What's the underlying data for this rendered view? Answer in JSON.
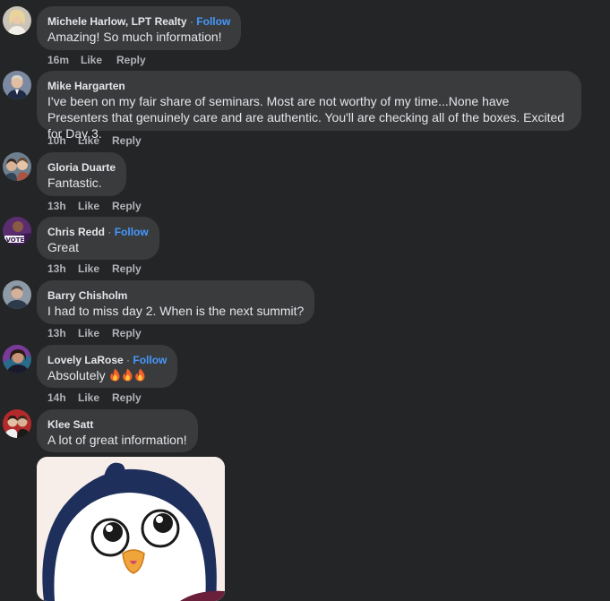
{
  "comments": [
    {
      "author": "Michele Harlow, LPT Realty",
      "follow": "Follow",
      "separator": "·",
      "text": "Amazing! So much information!",
      "time": "16m",
      "like": "Like",
      "reply": "Reply"
    },
    {
      "author": "Mike Hargarten",
      "text": "I've been on my fair share of seminars. Most are not worthy of my time...None have Presenters that genuinely care and are authentic. You'll are checking all of the boxes. Excited for Day 3.",
      "time": "10h",
      "like": "Like",
      "reply": "Reply"
    },
    {
      "author": "Gloria Duarte",
      "text": "Fantastic.",
      "time": "13h",
      "like": "Like",
      "reply": "Reply"
    },
    {
      "author": "Chris Redd",
      "follow": "Follow",
      "separator": "·",
      "text": "Great",
      "time": "13h",
      "like": "Like",
      "reply": "Reply"
    },
    {
      "author": "Barry Chisholm",
      "text": "I had to miss day 2. When is the next summit?",
      "time": "13h",
      "like": "Like",
      "reply": "Reply"
    },
    {
      "author": "Lovely LaRose",
      "follow": "Follow",
      "separator": "·",
      "text": "Absolutely",
      "time": "14h",
      "like": "Like",
      "reply": "Reply"
    },
    {
      "author": "Klee Satt",
      "text": "A lot of great information!"
    }
  ],
  "icons": {
    "fire": "fire-emoji-icon",
    "sticker": "penguin-sticker"
  },
  "colors": {
    "background": "#242526",
    "bubble": "#3a3b3c",
    "text": "#e4e6eb",
    "secondary_text": "#b0b3b8",
    "follow_link": "#4599ff"
  }
}
